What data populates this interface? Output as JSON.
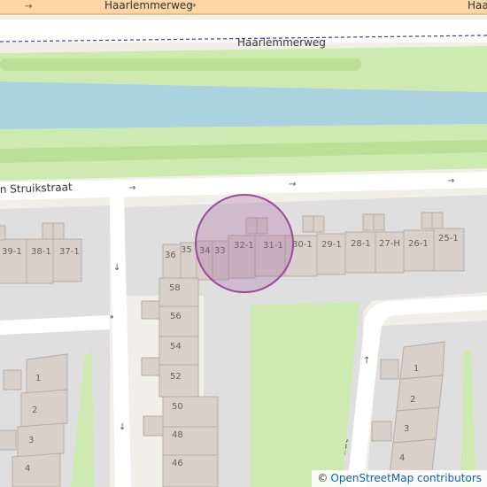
{
  "map": {
    "streets": {
      "top_road": "Haarlemmerweg",
      "top_road_edge": "Haarl",
      "service_road": "Haarlemmerweg",
      "left_street": "n Struikstraat",
      "bottom_street": "nnstraat"
    },
    "house_numbers": {
      "north_row": [
        "36",
        "35",
        "34",
        "33",
        "32-1",
        "31-1",
        "30-1",
        "29-1",
        "28-1",
        "27-H",
        "26-1",
        "25-1"
      ],
      "left_block": [
        "39-1",
        "38-1",
        "37-1"
      ],
      "column": [
        "58",
        "56",
        "54",
        "52",
        "50",
        "48",
        "46"
      ],
      "left_lower": [
        "1",
        "2",
        "3",
        "4"
      ],
      "right_lower": [
        "1",
        "2",
        "3",
        "4"
      ]
    },
    "marker": {
      "type": "location-circle",
      "color": "#9b4a9b"
    },
    "colors": {
      "primary_road": "#fcd6a4",
      "water": "#aad3df",
      "grass": "#cdebb0",
      "building": "#d9d0c9",
      "residential": "#e0dfdf"
    }
  },
  "attribution": {
    "symbol": "©",
    "text": "OpenStreetMap contributors"
  }
}
